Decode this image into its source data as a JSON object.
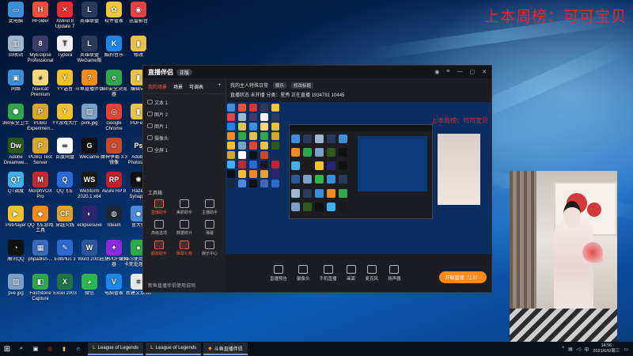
{
  "overlay": {
    "top_right_text": "上本周榜：可可宝贝"
  },
  "desktop_icons": [
    {
      "label": "此电脑",
      "color": "#3a8fd8",
      "glyph": "▭"
    },
    {
      "label": "HFolder",
      "color": "#e8523a",
      "glyph": "H"
    },
    {
      "label": "XMind 8 Update 7",
      "color": "#e03030",
      "glyph": "✕"
    },
    {
      "label": "英雄联盟",
      "color": "#2a3a5a",
      "glyph": "L"
    },
    {
      "label": "软件管家",
      "color": "#f2c73a",
      "glyph": "✿"
    },
    {
      "label": "迅雷影音",
      "color": "#e84040",
      "glyph": "◉"
    },
    {
      "label": "回收站",
      "color": "#9fb6cf",
      "glyph": "▥"
    },
    {
      "label": "MyEclipse Professional",
      "color": "#3b3b6a",
      "glyph": "8"
    },
    {
      "label": "Typora",
      "color": "#f0f0f0",
      "glyph": "T"
    },
    {
      "label": "英雄联盟 WeGame版",
      "color": "#2a3a5a",
      "glyph": "L"
    },
    {
      "label": "酷狗音乐",
      "color": "#1e86e6",
      "glyph": "K"
    },
    {
      "label": "修改",
      "color": "#e8c04a",
      "glyph": "▮"
    },
    {
      "label": "网络",
      "color": "#3a8fd8",
      "glyph": "▣"
    },
    {
      "label": "Navicat Premium",
      "color": "#f3d97a",
      "glyph": "◕"
    },
    {
      "label": "YY语音",
      "color": "#f2c12e",
      "glyph": "Y"
    },
    {
      "label": "斗鱼直播伴侣",
      "color": "#f28a1c",
      "glyph": "?"
    },
    {
      "label": "360安全浏览器",
      "color": "#2fa84a",
      "glyph": "e"
    },
    {
      "label": "编辑VS",
      "color": "#e8c04a",
      "glyph": "▮"
    },
    {
      "label": "360安全卫士",
      "color": "#2fa84a",
      "glyph": "⬢"
    },
    {
      "label": "PUBG Experimen...",
      "color": "#d9a52a",
      "glyph": "P"
    },
    {
      "label": "YY游戏大厅",
      "color": "#f2c12e",
      "glyph": "Y"
    },
    {
      "label": "pvrk.jpg",
      "color": "#7aa0c8",
      "glyph": "▨"
    },
    {
      "label": "Google Chrome",
      "color": "#ea4335",
      "glyph": "◎"
    },
    {
      "label": "PDFe...",
      "color": "#e8c04a",
      "glyph": "▮"
    },
    {
      "label": "Adobe Dreamwe...",
      "color": "#2d5a1b",
      "glyph": "Dw"
    },
    {
      "label": "PUBG Test Server",
      "color": "#d9a52a",
      "glyph": "P"
    },
    {
      "label": "百度网盘",
      "color": "#ffffff",
      "glyph": "∞"
    },
    {
      "label": "WeGame",
      "color": "#111111",
      "glyph": "G"
    },
    {
      "label": "魔神争霸 3.3 镜像",
      "color": "#c84a2a",
      "glyph": "☺"
    },
    {
      "label": "Adobe Photosh...",
      "color": "#0d2a5a",
      "glyph": "Ps"
    },
    {
      "label": "QT调度",
      "color": "#41b0ee",
      "glyph": "QT"
    },
    {
      "label": "MorphVOX Pro",
      "color": "#c02c2c",
      "glyph": "M"
    },
    {
      "label": "QQ飞车",
      "color": "#2a6ad8",
      "glyph": "Q"
    },
    {
      "label": "WeStorm 2020.1 x64",
      "color": "#1a1a1a",
      "glyph": "WS"
    },
    {
      "label": "Avure RP 8",
      "color": "#c81e2a",
      "glyph": "RP"
    },
    {
      "label": "Razer Synapse",
      "color": "#111111",
      "glyph": "✺"
    },
    {
      "label": "PotPlayer",
      "color": "#f2c12e",
      "glyph": "▶"
    },
    {
      "label": "QQ飞车游戏 工具",
      "color": "#f28a1c",
      "glyph": "◆"
    },
    {
      "label": "穿越火线",
      "color": "#e8a02a",
      "glyph": "CF"
    },
    {
      "label": "eclipsesuve",
      "color": "#2c2470",
      "glyph": "◐"
    },
    {
      "label": "Steam",
      "color": "#1b2838",
      "glyph": "◍"
    },
    {
      "label": "鲁大师",
      "color": "#4a8ad8",
      "glyph": "☻"
    },
    {
      "label": "腾讯QQ",
      "color": "#111111",
      "glyph": "◔"
    },
    {
      "label": "phpadlsn-...",
      "color": "#3a6ab8",
      "glyph": "▦"
    },
    {
      "label": "EditPlus 3",
      "color": "#2c6ad0",
      "glyph": "✎"
    },
    {
      "label": "Word 2003",
      "color": "#2b579a",
      "glyph": "W"
    },
    {
      "label": "迅捷PDF编辑器",
      "color": "#8a2ad8",
      "glyph": "✦"
    },
    {
      "label": "KES使用检测 卡死处理工具",
      "color": "#2fa84a",
      "glyph": "●"
    },
    {
      "label": "pve.jpg",
      "color": "#7aa0c8",
      "glyph": "▨"
    },
    {
      "label": "FastStone Capture",
      "color": "#2fa84a",
      "glyph": "◧"
    },
    {
      "label": "Excel 2003",
      "color": "#217346",
      "glyph": "X"
    },
    {
      "label": "微信",
      "color": "#2fb84a",
      "glyph": "◕"
    },
    {
      "label": "电脑管家",
      "color": "#1e86e6",
      "glyph": "V"
    },
    {
      "label": "新建文本.txt",
      "color": "#e8e8e8",
      "glyph": "≡"
    }
  ],
  "app": {
    "title": "直播伴侣",
    "version": "正版",
    "left_tabs": [
      "我的场景",
      "场景",
      "可调表"
    ],
    "sources": [
      "文本 1",
      "图片 2",
      "图片 1",
      "摄像头",
      "全屏 1"
    ],
    "tools_title": "工具箱",
    "tools": [
      {
        "label": "直播助手",
        "active": true
      },
      {
        "label": "美颜助手",
        "active": false
      },
      {
        "label": "主播助手",
        "active": false
      },
      {
        "label": "高级选项",
        "active": false
      },
      {
        "label": "数据统计",
        "active": false
      },
      {
        "label": "弹幕",
        "active": false
      },
      {
        "label": "超级助手",
        "active": true
      },
      {
        "label": "弹幕礼物",
        "active": true
      },
      {
        "label": "娱乐中心",
        "active": false
      }
    ],
    "left_footer": "新鱼直播伴侣使用说明",
    "stream_title": "我的主人特殊日常",
    "stream_tag": "娱乐",
    "stream_edit": "修改标题",
    "stream_info_line": "直播状态  未开播  分类：星秀  正在直播 1934791  10445",
    "preview_overlay": "上本周榜：可可宝贝",
    "bottom_buttons": [
      "直播预告",
      "摄像头",
      "手机直播",
      "画面",
      "麦克风",
      "扬声器"
    ],
    "go_live": "开始直播（1.0）"
  },
  "taskbar": {
    "start_glyph": "⊞",
    "tasks": [
      "League of Legends",
      "League of Legends",
      "斗鱼直播伴侣"
    ],
    "time": "14:56",
    "date": "2021/6/6/周三",
    "lang": "中"
  }
}
